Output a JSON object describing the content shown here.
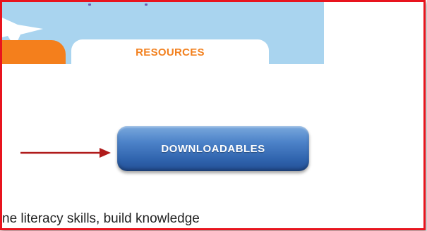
{
  "tabs": {
    "resources_label": "RESOURCES"
  },
  "main": {
    "downloadables_label": "DOWNLOADABLES",
    "body_text": "ne literacy skills, build knowledge"
  },
  "icons": {
    "star": "star-icon",
    "arrow": "arrow-right-icon"
  },
  "colors": {
    "highlight_border": "#e8141e",
    "header_band": "#a9d4ef",
    "tab_orange": "#f47f1c",
    "tab_label": "#f2801e",
    "button_blue": "#2f63ad",
    "arrow": "#b01b1b"
  }
}
